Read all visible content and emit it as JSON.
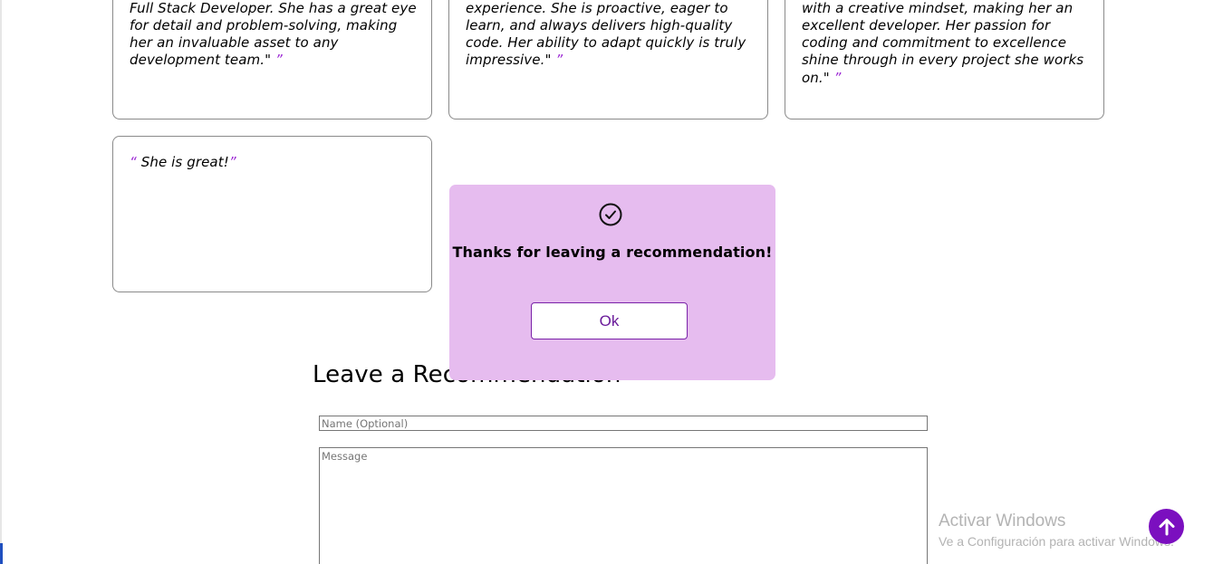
{
  "recommendations": [
    {
      "text": "Full Stack Developer. She has a great eye\nfor detail and problem-solving, making\nher an invaluable asset to any\ndevelopment team.\"",
      "close_quote": "”"
    },
    {
      "text": "experience. She is proactive, eager to\nlearn, and always delivers high-quality\ncode. Her ability to adapt quickly is truly\nimpressive.\"",
      "close_quote": "”"
    },
    {
      "text": "with a creative mindset, making her an\nexcellent developer. Her passion for\ncoding and commitment to excellence\nshine through in every project she works\non.\"",
      "close_quote": "”"
    },
    {
      "open_quote": "“",
      "text": " She is great!",
      "close_quote": "”"
    }
  ],
  "form": {
    "title": "Leave a Recommendation",
    "name_placeholder": "Name (Optional)",
    "message_placeholder": "Message"
  },
  "modal": {
    "icon": "check-circle-icon",
    "message": "Thanks for leaving a recommendation!",
    "ok_label": "Ok"
  },
  "watermark": {
    "title": "Activar Windows",
    "subtitle": "Ve a Configuración para activar Windows."
  },
  "scroll_top": {
    "icon": "arrow-up-icon"
  },
  "colors": {
    "accent": "#7b0fbf",
    "modal_bg": "#e6bcef",
    "quote": "#9c27d4"
  }
}
